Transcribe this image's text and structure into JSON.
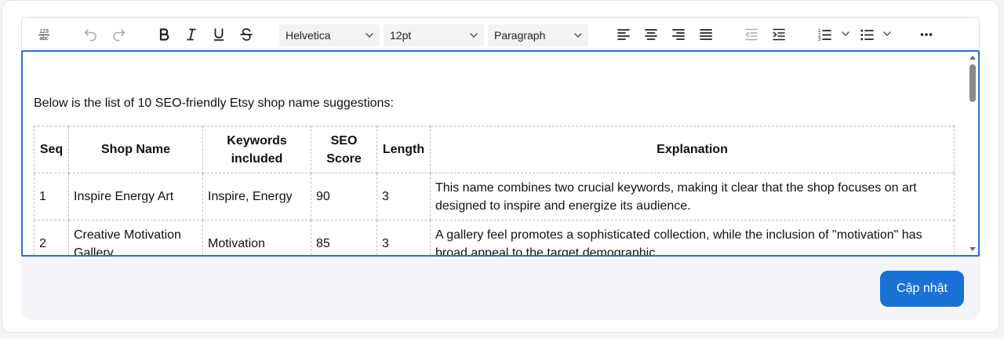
{
  "toolbar": {
    "font_family": "Helvetica",
    "font_size": "12pt",
    "block_format": "Paragraph"
  },
  "editor": {
    "intro": "Below is the list of 10 SEO-friendly Etsy shop name suggestions:",
    "table": {
      "headers": [
        "Seq",
        "Shop Name",
        "Keywords included",
        "SEO Score",
        "Length",
        "Explanation"
      ],
      "rows": [
        [
          "1",
          "Inspire Energy Art",
          "Inspire, Energy",
          "90",
          "3",
          "This name combines two crucial keywords, making it clear that the shop focuses on art designed to inspire and energize its audience."
        ],
        [
          "2",
          "Creative Motivation Gallery",
          "Motivation",
          "85",
          "3",
          "A gallery feel promotes a sophisticated collection, while the inclusion of \"motivation\" has broad appeal to the target demographic."
        ]
      ]
    }
  },
  "update_label": "Cập nhật",
  "colors": {
    "accent": "#1a73d4",
    "editor_border": "#2b6fce"
  }
}
